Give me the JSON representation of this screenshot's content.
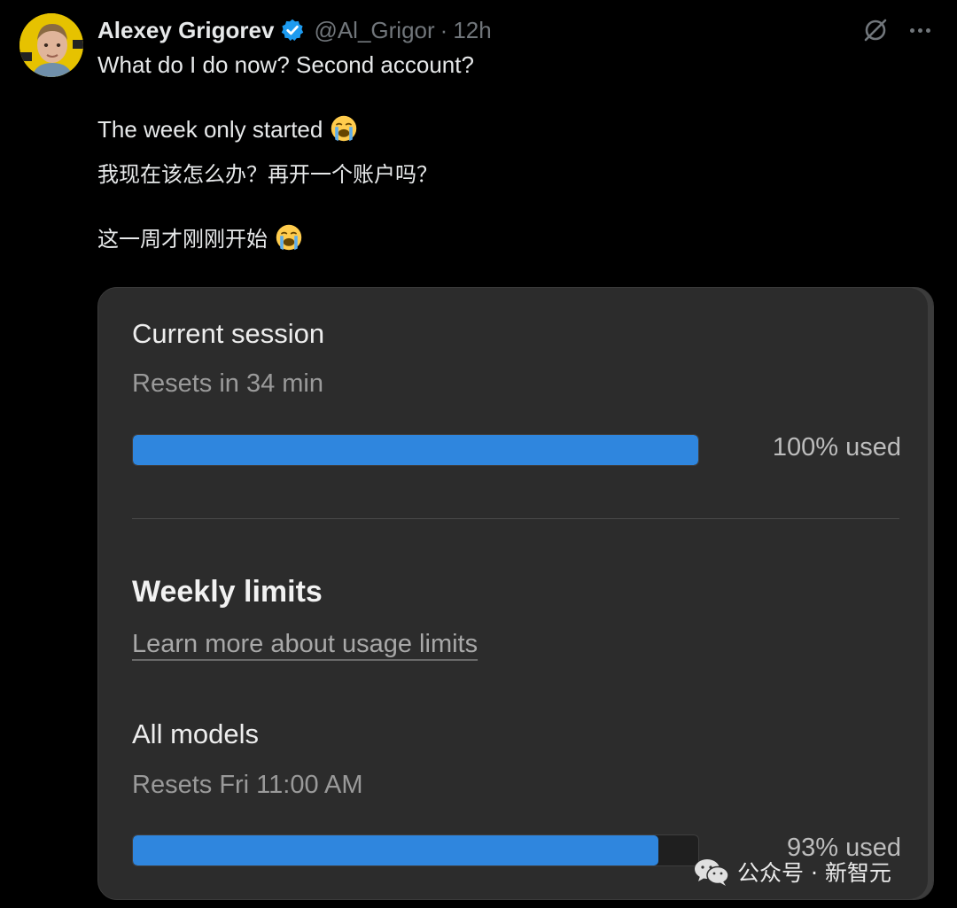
{
  "tweet": {
    "author_name": "Alexey Grigorev",
    "handle": "@Al_Grigor",
    "separator": "·",
    "time_ago": "12h",
    "line1": "What do I do now? Second account?",
    "line2": "The week only started",
    "line3": "我现在该怎么办？再开一个账户吗？",
    "line4": "这一周才刚刚开始",
    "emoji": "loudly-crying-face"
  },
  "card": {
    "current_session": {
      "title": "Current session",
      "reset_text": "Resets in 34 min",
      "used_label": "100% used",
      "used_fraction": 1.0
    },
    "weekly": {
      "title": "Weekly limits",
      "link_text": "Learn more about usage limits"
    },
    "all_models": {
      "title": "All models",
      "reset_text": "Resets Fri 11:00 AM",
      "used_label": "93% used",
      "used_fraction": 0.93
    },
    "bar_color": "#2f86de"
  },
  "watermark": {
    "text": "公众号 · 新智元",
    "icon": "wechat-icon"
  },
  "colors": {
    "verified_blue": "#1d9bf0",
    "muted": "#71767b"
  }
}
